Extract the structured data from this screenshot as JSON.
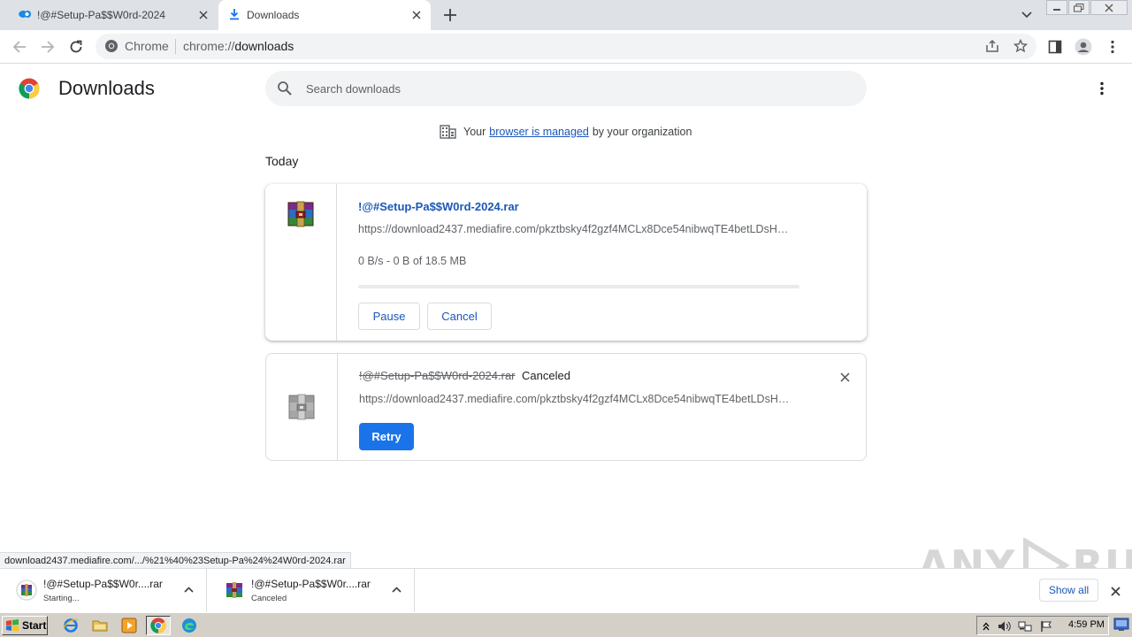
{
  "tabs": [
    {
      "title": "!@#Setup-Pa$$W0rd-2024",
      "favicon": "mediafire-icon",
      "active": false
    },
    {
      "title": "Downloads",
      "favicon": "download-icon",
      "active": true
    }
  ],
  "omnibox": {
    "site_label": "Chrome",
    "url_scheme": "chrome://",
    "url_path": "downloads"
  },
  "page": {
    "title": "Downloads",
    "search_placeholder": "Search downloads",
    "managed": {
      "prefix": "Your",
      "link": "browser is managed",
      "suffix": "by your organization"
    },
    "section_label": "Today"
  },
  "downloads": [
    {
      "file_name": "!@#Setup-Pa$$W0rd-2024.rar",
      "url": "https://download2437.mediafire.com/pkztbsky4f2gzf4MCLx8Dce54nibwqTE4betLDsH…",
      "progress_text": "0 B/s - 0 B of 18.5 MB",
      "progress_fraction": 0,
      "pause_label": "Pause",
      "cancel_label": "Cancel"
    },
    {
      "file_name": "!@#Setup-Pa$$W0rd-2024.rar",
      "status": "Canceled",
      "url": "https://download2437.mediafire.com/pkztbsky4f2gzf4MCLx8Dce54nibwqTE4betLDsH…",
      "retry_label": "Retry"
    }
  ],
  "status_bubble": "download2437.mediafire.com/.../%21%40%23Setup-Pa%24%24W0rd-2024.rar",
  "shelf": {
    "items": [
      {
        "name": "!@#Setup-Pa$$W0r....rar",
        "status": "Starting..."
      },
      {
        "name": "!@#Setup-Pa$$W0r....rar",
        "status": "Canceled"
      }
    ],
    "show_all_label": "Show all"
  },
  "watermark": {
    "left": "ANY",
    "right": "RUN"
  },
  "taskbar": {
    "start_label": "Start",
    "clock": "4:59 PM"
  },
  "colors": {
    "accent": "#1a73e8",
    "link": "#1a57b8",
    "tabstrip": "#dee1e6",
    "taskbar": "#d4d0c8"
  }
}
